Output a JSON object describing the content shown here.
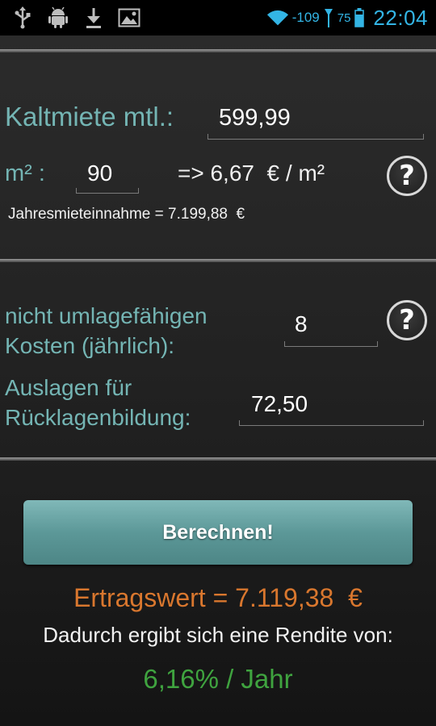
{
  "status_bar": {
    "signal_strength": "-109",
    "battery_level": "75",
    "time": "22:04",
    "icons": [
      "usb-icon",
      "android-debug-icon",
      "download-icon",
      "image-icon",
      "wifi-icon",
      "signal-icon",
      "battery-icon"
    ]
  },
  "rent": {
    "label": "Kaltmiete mtl.:",
    "value": "599,99"
  },
  "area": {
    "label": "m² :",
    "value": "90",
    "per_sqm_text": "=> 6,67  € / m²"
  },
  "annual_income_text": "Jahresmieteinnahme = 7.199,88  €",
  "costs": {
    "label_line1": "nicht umlagefähigen",
    "label_line2": "Kosten (jährlich):",
    "value": "8"
  },
  "reserves": {
    "label_line1": "Auslagen für",
    "label_line2": "Rücklagenbildung:",
    "value": "72,50"
  },
  "help_button_label": "?",
  "calculate_button_label": "Berechnen!",
  "result": {
    "ertragswert_text": "Ertragswert = 7.119,38  €",
    "rendite_intro": "Dadurch ergibt sich eine Rendite von:",
    "rendite_value": "6,16% / Jahr"
  },
  "colors": {
    "label_teal": "#74b5b4",
    "result_orange": "#d9772e",
    "rendite_green": "#3fa33f",
    "status_blue": "#33b5e5",
    "button_teal": "#5c9898"
  }
}
